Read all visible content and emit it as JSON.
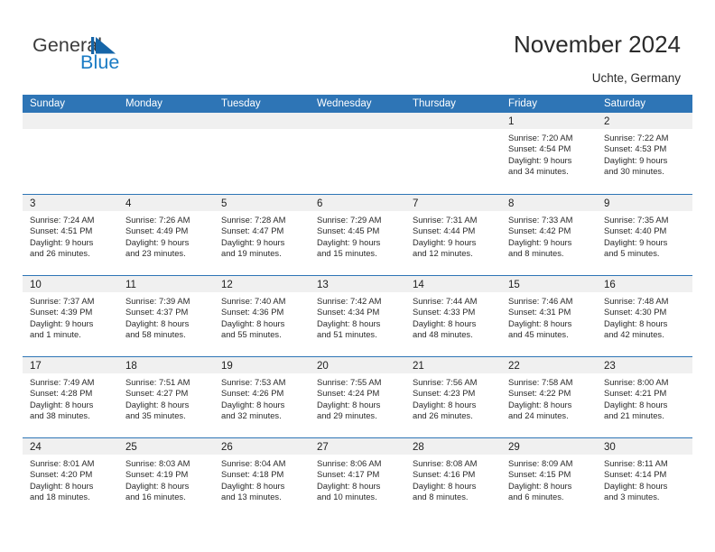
{
  "brand": {
    "name_top": "General",
    "name_bottom": "Blue",
    "triangle_icon": "blue-triangle-icon",
    "accent_color": "#1a7bc4"
  },
  "header": {
    "title": "November 2024",
    "location": "Uchte, Germany"
  },
  "calendar": {
    "header_bg": "#2e75b6",
    "daystrip_bg": "#f0f0f0",
    "weekday_headers": [
      "Sunday",
      "Monday",
      "Tuesday",
      "Wednesday",
      "Thursday",
      "Friday",
      "Saturday"
    ],
    "weeks": [
      [
        {
          "day": "",
          "lines": []
        },
        {
          "day": "",
          "lines": []
        },
        {
          "day": "",
          "lines": []
        },
        {
          "day": "",
          "lines": []
        },
        {
          "day": "",
          "lines": []
        },
        {
          "day": "1",
          "lines": [
            "Sunrise: 7:20 AM",
            "Sunset: 4:54 PM",
            "Daylight: 9 hours",
            "and 34 minutes."
          ]
        },
        {
          "day": "2",
          "lines": [
            "Sunrise: 7:22 AM",
            "Sunset: 4:53 PM",
            "Daylight: 9 hours",
            "and 30 minutes."
          ]
        }
      ],
      [
        {
          "day": "3",
          "lines": [
            "Sunrise: 7:24 AM",
            "Sunset: 4:51 PM",
            "Daylight: 9 hours",
            "and 26 minutes."
          ]
        },
        {
          "day": "4",
          "lines": [
            "Sunrise: 7:26 AM",
            "Sunset: 4:49 PM",
            "Daylight: 9 hours",
            "and 23 minutes."
          ]
        },
        {
          "day": "5",
          "lines": [
            "Sunrise: 7:28 AM",
            "Sunset: 4:47 PM",
            "Daylight: 9 hours",
            "and 19 minutes."
          ]
        },
        {
          "day": "6",
          "lines": [
            "Sunrise: 7:29 AM",
            "Sunset: 4:45 PM",
            "Daylight: 9 hours",
            "and 15 minutes."
          ]
        },
        {
          "day": "7",
          "lines": [
            "Sunrise: 7:31 AM",
            "Sunset: 4:44 PM",
            "Daylight: 9 hours",
            "and 12 minutes."
          ]
        },
        {
          "day": "8",
          "lines": [
            "Sunrise: 7:33 AM",
            "Sunset: 4:42 PM",
            "Daylight: 9 hours",
            "and 8 minutes."
          ]
        },
        {
          "day": "9",
          "lines": [
            "Sunrise: 7:35 AM",
            "Sunset: 4:40 PM",
            "Daylight: 9 hours",
            "and 5 minutes."
          ]
        }
      ],
      [
        {
          "day": "10",
          "lines": [
            "Sunrise: 7:37 AM",
            "Sunset: 4:39 PM",
            "Daylight: 9 hours",
            "and 1 minute."
          ]
        },
        {
          "day": "11",
          "lines": [
            "Sunrise: 7:39 AM",
            "Sunset: 4:37 PM",
            "Daylight: 8 hours",
            "and 58 minutes."
          ]
        },
        {
          "day": "12",
          "lines": [
            "Sunrise: 7:40 AM",
            "Sunset: 4:36 PM",
            "Daylight: 8 hours",
            "and 55 minutes."
          ]
        },
        {
          "day": "13",
          "lines": [
            "Sunrise: 7:42 AM",
            "Sunset: 4:34 PM",
            "Daylight: 8 hours",
            "and 51 minutes."
          ]
        },
        {
          "day": "14",
          "lines": [
            "Sunrise: 7:44 AM",
            "Sunset: 4:33 PM",
            "Daylight: 8 hours",
            "and 48 minutes."
          ]
        },
        {
          "day": "15",
          "lines": [
            "Sunrise: 7:46 AM",
            "Sunset: 4:31 PM",
            "Daylight: 8 hours",
            "and 45 minutes."
          ]
        },
        {
          "day": "16",
          "lines": [
            "Sunrise: 7:48 AM",
            "Sunset: 4:30 PM",
            "Daylight: 8 hours",
            "and 42 minutes."
          ]
        }
      ],
      [
        {
          "day": "17",
          "lines": [
            "Sunrise: 7:49 AM",
            "Sunset: 4:28 PM",
            "Daylight: 8 hours",
            "and 38 minutes."
          ]
        },
        {
          "day": "18",
          "lines": [
            "Sunrise: 7:51 AM",
            "Sunset: 4:27 PM",
            "Daylight: 8 hours",
            "and 35 minutes."
          ]
        },
        {
          "day": "19",
          "lines": [
            "Sunrise: 7:53 AM",
            "Sunset: 4:26 PM",
            "Daylight: 8 hours",
            "and 32 minutes."
          ]
        },
        {
          "day": "20",
          "lines": [
            "Sunrise: 7:55 AM",
            "Sunset: 4:24 PM",
            "Daylight: 8 hours",
            "and 29 minutes."
          ]
        },
        {
          "day": "21",
          "lines": [
            "Sunrise: 7:56 AM",
            "Sunset: 4:23 PM",
            "Daylight: 8 hours",
            "and 26 minutes."
          ]
        },
        {
          "day": "22",
          "lines": [
            "Sunrise: 7:58 AM",
            "Sunset: 4:22 PM",
            "Daylight: 8 hours",
            "and 24 minutes."
          ]
        },
        {
          "day": "23",
          "lines": [
            "Sunrise: 8:00 AM",
            "Sunset: 4:21 PM",
            "Daylight: 8 hours",
            "and 21 minutes."
          ]
        }
      ],
      [
        {
          "day": "24",
          "lines": [
            "Sunrise: 8:01 AM",
            "Sunset: 4:20 PM",
            "Daylight: 8 hours",
            "and 18 minutes."
          ]
        },
        {
          "day": "25",
          "lines": [
            "Sunrise: 8:03 AM",
            "Sunset: 4:19 PM",
            "Daylight: 8 hours",
            "and 16 minutes."
          ]
        },
        {
          "day": "26",
          "lines": [
            "Sunrise: 8:04 AM",
            "Sunset: 4:18 PM",
            "Daylight: 8 hours",
            "and 13 minutes."
          ]
        },
        {
          "day": "27",
          "lines": [
            "Sunrise: 8:06 AM",
            "Sunset: 4:17 PM",
            "Daylight: 8 hours",
            "and 10 minutes."
          ]
        },
        {
          "day": "28",
          "lines": [
            "Sunrise: 8:08 AM",
            "Sunset: 4:16 PM",
            "Daylight: 8 hours",
            "and 8 minutes."
          ]
        },
        {
          "day": "29",
          "lines": [
            "Sunrise: 8:09 AM",
            "Sunset: 4:15 PM",
            "Daylight: 8 hours",
            "and 6 minutes."
          ]
        },
        {
          "day": "30",
          "lines": [
            "Sunrise: 8:11 AM",
            "Sunset: 4:14 PM",
            "Daylight: 8 hours",
            "and 3 minutes."
          ]
        }
      ]
    ]
  }
}
